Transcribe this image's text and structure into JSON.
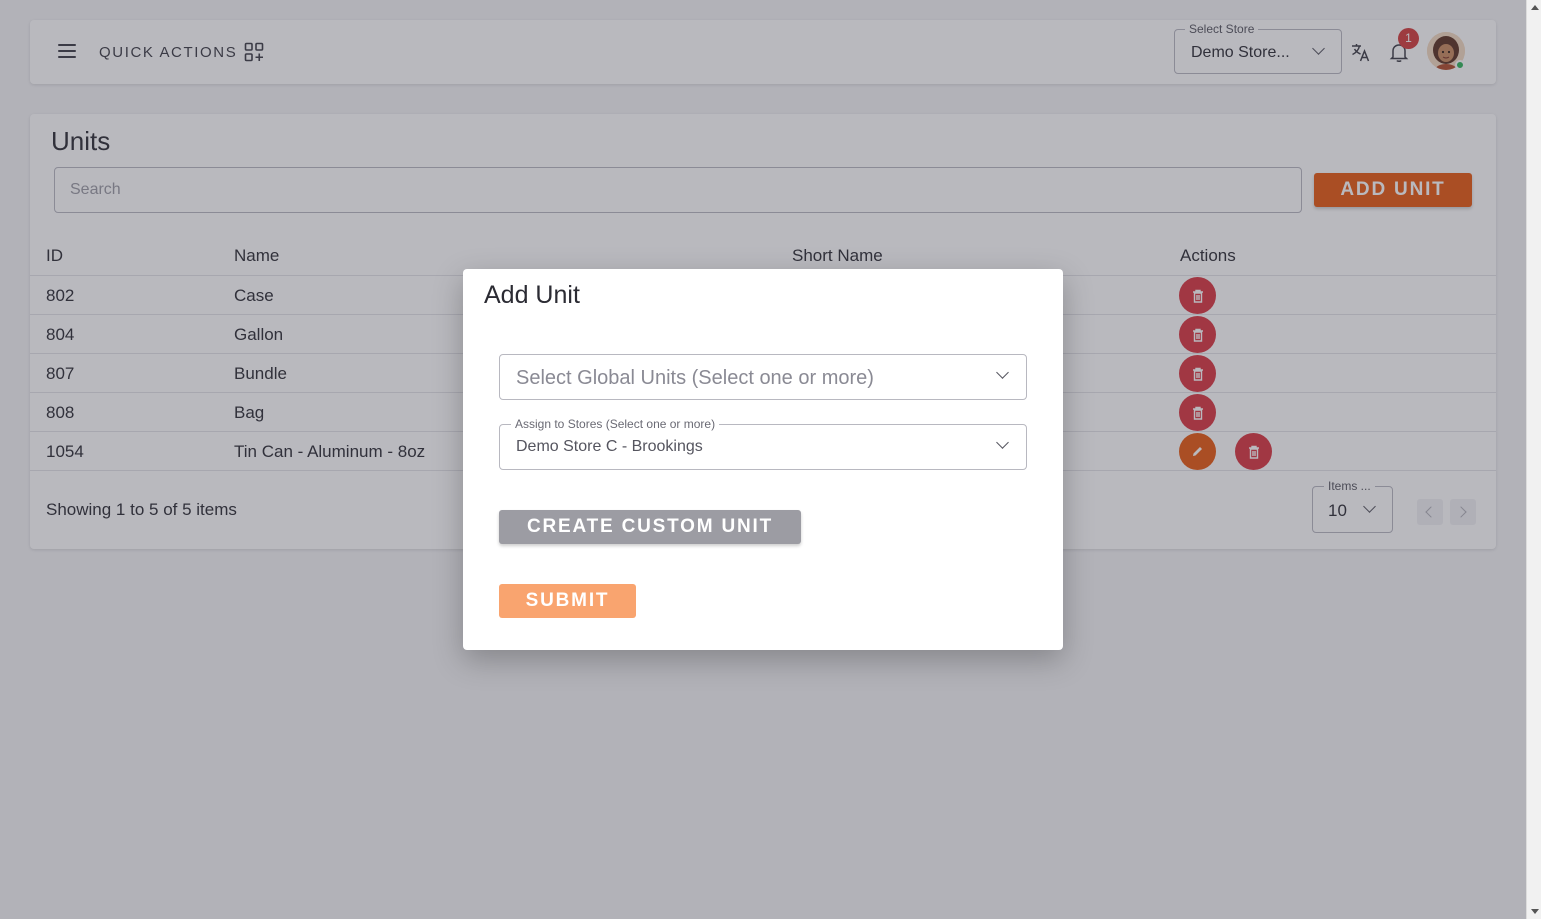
{
  "header": {
    "quick_actions_label": "QUICK ACTIONS",
    "store_select": {
      "legend": "Select Store",
      "value": "Demo Store..."
    },
    "notification_count": "1"
  },
  "units_page": {
    "title": "Units",
    "search_placeholder": "Search",
    "add_button": "ADD UNIT",
    "columns": {
      "id": "ID",
      "name": "Name",
      "short_name": "Short Name",
      "actions": "Actions"
    },
    "rows": [
      {
        "id": "802",
        "name": "Case",
        "short_name": "",
        "can_edit": false
      },
      {
        "id": "804",
        "name": "Gallon",
        "short_name": "",
        "can_edit": false
      },
      {
        "id": "807",
        "name": "Bundle",
        "short_name": "",
        "can_edit": false
      },
      {
        "id": "808",
        "name": "Bag",
        "short_name": "",
        "can_edit": false
      },
      {
        "id": "1054",
        "name": "Tin Can - Aluminum - 8oz",
        "short_name": "",
        "can_edit": true
      }
    ],
    "showing_text": "Showing 1 to 5 of 5 items",
    "items_per_page": {
      "legend": "Items ...",
      "value": "10"
    }
  },
  "modal": {
    "title": "Add Unit",
    "global_units_placeholder": "Select Global Units (Select one or more)",
    "assign_stores": {
      "legend": "Assign to Stores (Select one or more)",
      "value": "Demo Store C - Brookings"
    },
    "create_custom_button": "CREATE CUSTOM UNIT",
    "submit_button": "SUBMIT"
  },
  "colors": {
    "accent": "#e8580f",
    "delete": "#d9343f",
    "submit_disabled": "#f9a46f",
    "secondary_button": "#9c9ca3",
    "online": "#2fb45a"
  },
  "icons": {
    "menu": "hamburger-icon",
    "quick_actions": "grid-plus-icon",
    "translate": "translate-icon",
    "notifications": "bell-icon",
    "edit": "pencil-icon",
    "delete": "trash-icon"
  }
}
